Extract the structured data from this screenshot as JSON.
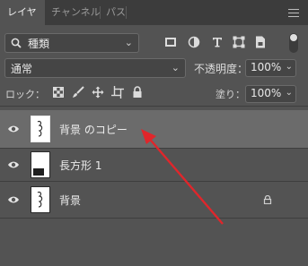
{
  "tabs": [
    {
      "label": "レイヤー",
      "active": true
    },
    {
      "label": "チャンネル",
      "active": false
    },
    {
      "label": "パス",
      "active": false
    }
  ],
  "filter": {
    "kind_label": "種類"
  },
  "blend_mode": "通常",
  "opacity": {
    "label": "不透明度：",
    "value": "100%"
  },
  "lock": {
    "label": "ロック："
  },
  "fill": {
    "label": "塗り：",
    "value": "100%"
  },
  "layers": [
    {
      "name": "背景 のコピー",
      "selected": true,
      "visible": true,
      "locked": false
    },
    {
      "name": "長方形 1",
      "selected": false,
      "visible": true,
      "locked": false
    },
    {
      "name": "背景",
      "selected": false,
      "visible": true,
      "locked": true
    }
  ],
  "colors": {
    "panel": "#535353",
    "tabbar": "#3c3c3c",
    "selected_row": "#6b6b6b",
    "annotation_arrow": "#e0262b"
  },
  "icons": [
    "search-icon",
    "image-filter-icon",
    "adjustment-filter-icon",
    "type-filter-icon",
    "shape-filter-icon",
    "smart-object-filter-icon",
    "lock-transparent-icon",
    "lock-paint-icon",
    "lock-position-icon",
    "lock-artboard-icon",
    "lock-all-icon",
    "eye-icon",
    "panel-menu-icon"
  ]
}
